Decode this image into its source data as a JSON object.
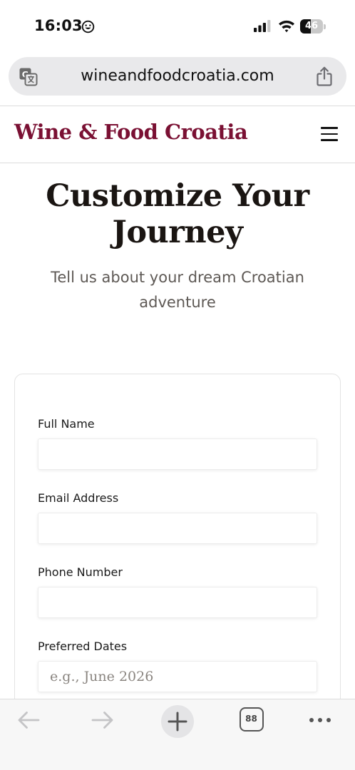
{
  "status_bar": {
    "time": "16:03",
    "battery": "46",
    "battery_level": 0.46
  },
  "browser": {
    "url": "wineandfoodcroatia.com",
    "tabs_count": "88"
  },
  "site": {
    "logo": "Wine & Food Croatia"
  },
  "hero": {
    "title_line1": "Customize Your",
    "title_line2": "Journey",
    "subtitle_line1": "Tell us about your dream Croatian",
    "subtitle_line2": "adventure"
  },
  "form": {
    "fields": [
      {
        "label": "Full Name",
        "value": "",
        "placeholder": ""
      },
      {
        "label": "Email Address",
        "value": "",
        "placeholder": ""
      },
      {
        "label": "Phone Number",
        "value": "",
        "placeholder": ""
      },
      {
        "label": "Preferred Dates",
        "value": "",
        "placeholder": "e.g., June 2026"
      }
    ]
  },
  "colors": {
    "brand": "#7a1033",
    "title": "#1a1512",
    "subtitle": "#5e5955",
    "url_bar": "#e9e9eb"
  },
  "icons": {
    "status": [
      "smile-icon",
      "signal-icon",
      "wifi-icon",
      "battery-icon"
    ],
    "url_bar": [
      "translate-icon",
      "share-icon"
    ],
    "header": [
      "menu-icon"
    ],
    "toolbar": [
      "back-icon",
      "forward-icon",
      "plus-icon",
      "tabs-icon",
      "more-icon"
    ]
  }
}
